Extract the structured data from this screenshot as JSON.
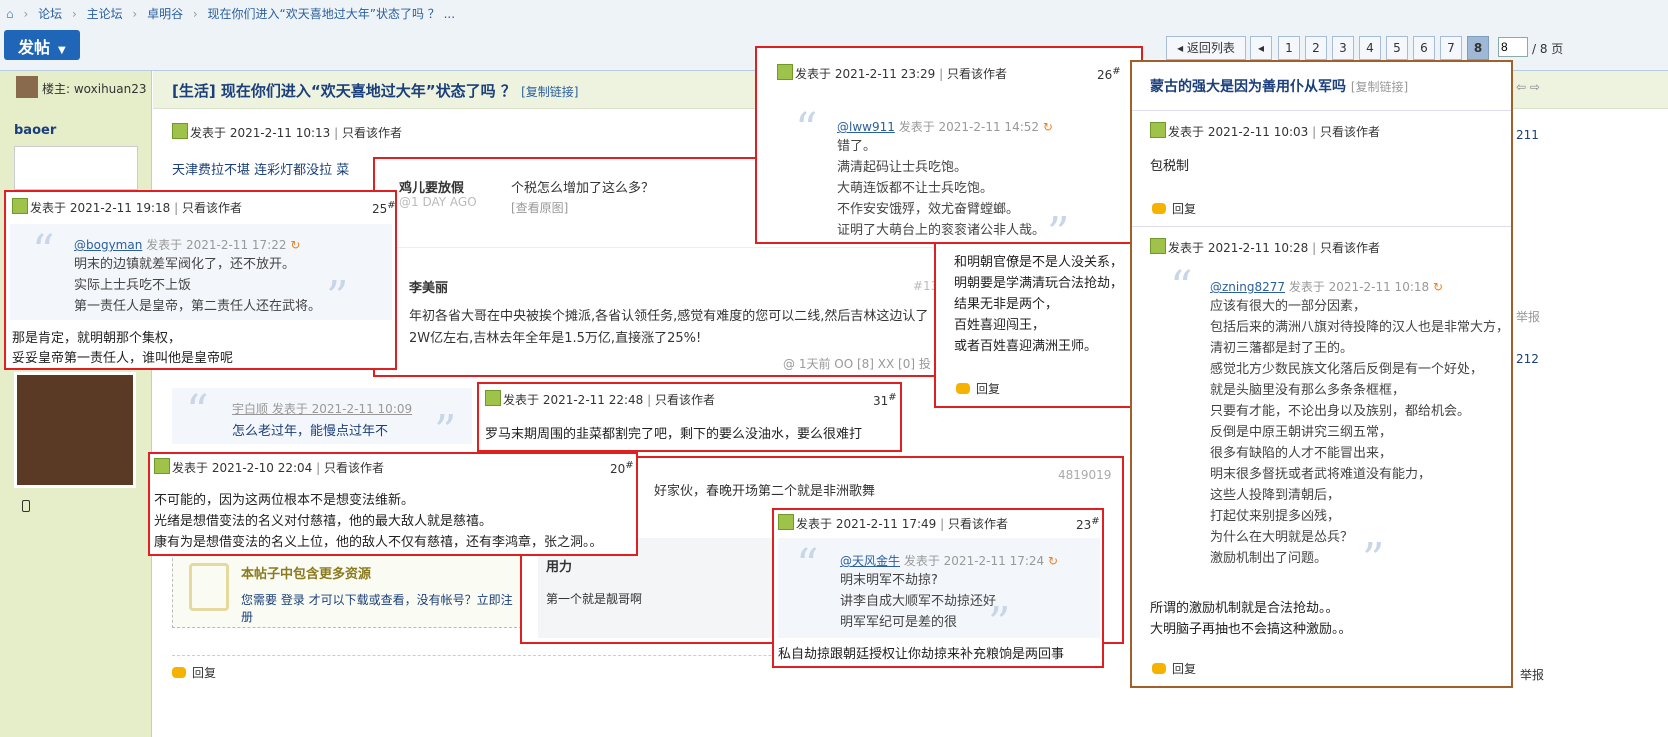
{
  "breadcrumb": {
    "items": [
      "论坛",
      "主论坛",
      "卓明谷",
      "现在你们进入“欢天喜地过大年”状态了吗 ？ ..."
    ]
  },
  "toolbar": {
    "post_label": "发帖"
  },
  "pager": {
    "back": "返回列表",
    "pages": [
      "1",
      "2",
      "3",
      "4",
      "5",
      "6",
      "7",
      "8"
    ],
    "current": "8",
    "input_value": "8",
    "total": "/ 8 页"
  },
  "thread": {
    "owner_label": "楼主: woxihuan23",
    "title": "[生活] 现在你们进入“欢天喜地过大年”状态了吗 ？",
    "copy_link": "[复制链接]"
  },
  "sidebar": {
    "username": "baoer"
  },
  "main_post": {
    "meta": "发表于 2021-2-11 10:13",
    "author_only": "只看该作者",
    "headline": "天津费拉不堪 连彩灯都没拉 菜",
    "quote_author": "宇白顺 发表于 2021-2-11 10:09",
    "quote_text": "怎么老过年，能慢点过年不",
    "resource_title": "本帖子中包含更多资源",
    "resource_text": "您需要 登录 才可以下载或查看，没有帐号？立即注册",
    "reply": "回复"
  },
  "right_edge": {
    "floor211": "211",
    "floor212": "212",
    "report": "举报"
  },
  "boxes": {
    "b25": {
      "meta": "发表于 2021-2-11 19:18",
      "author_only": "只看该作者",
      "floor": "25",
      "quote_user": "@bogyman",
      "quote_time": "发表于 2021-2-11 17:22",
      "quote_lines": [
        "明末的边镇就差军阀化了，还不放开。",
        "实际上士兵吃不上饭",
        "第一责任人是皇帝，第二责任人还在武将。"
      ],
      "body": [
        "那是肯定，就明朝那个集权，",
        "妥妥皇帝第一责任人，谁叫他是皇帝呢"
      ]
    },
    "weibo": {
      "name1": "鸡儿要放假",
      "time1": "@1 DAY AGO",
      "text1": "个税怎么增加了这么多？",
      "orig": "[查看原图]",
      "name2": "李美丽",
      "floor": "#13",
      "text2a": "年初各省大哥在中央被挨个摊派,各省认领任务,感觉有难度的您可以二线,然后吉林这边认了",
      "text2b": "2W亿左右,吉林去年全年是1.5万亿,直接涨了25%!",
      "footer": "@ 1天前  OO [8]  XX [0]  投"
    },
    "b26": {
      "meta": "发表于 2021-2-11 23:29",
      "author_only": "只看该作者",
      "floor": "26",
      "quote_user": "@lww911",
      "quote_time": "发表于 2021-2-11 14:52",
      "quote_lines": [
        "错了。",
        "满清起码让士兵吃饱。",
        "大萌连饭都不让士兵吃饱。",
        "不作安安饿殍，效尤奋臂螳螂。",
        "证明了大萌台上的衮衮诸公非人哉。"
      ]
    },
    "b26body": {
      "lines": [
        "和明朝官僚是不是人没关系，",
        "明朝要是学满清玩合法抢劫，",
        "结果无非是两个，",
        "百姓喜迎闯王，",
        "或者百姓喜迎满洲王师。"
      ],
      "reply": "回复"
    },
    "b31": {
      "meta": "发表于 2021-2-11 22:48",
      "author_only": "只看该作者",
      "floor": "31",
      "body": "罗马末期周围的韭菜都割完了吧，剩下的要么没油水，要么很难打"
    },
    "b20": {
      "meta": "发表于 2021-2-10 22:04",
      "author_only": "只看该作者",
      "floor": "20",
      "body": [
        "不可能的，因为这两位根本不是想变法维新。",
        "光绪是想借变法的名义对付慈禧，他的最大敌人就是慈禧。",
        "康有为是想借变法的名义上位，他的敌人不仅有慈禧，还有李鸿章，张之洞。。"
      ]
    },
    "bmid": {
      "text": "好家伙，春晚开场第二个就是非洲歌舞",
      "id": "4819019",
      "sub_title": "用力",
      "sub_text": "第一个就是靓哥啊"
    },
    "b23": {
      "meta": "发表于 2021-2-11 17:49",
      "author_only": "只看该作者",
      "floor": "23",
      "quote_user": "@天风金牛",
      "quote_time": "发表于 2021-2-11 17:24",
      "quote_lines": [
        "明末明军不劫掠?",
        "讲李自成大顺军不劫掠还好",
        "明军军纪可是差的很"
      ],
      "body": "私自劫掠跟朝廷授权让你劫掠来补充粮饷是两回事"
    },
    "bright": {
      "title": "蒙古的强大是因为善用仆从军吗",
      "copy": "[复制链接]",
      "meta1": "发表于 2021-2-11 10:03",
      "author_only": "只看该作者",
      "body1": "包税制",
      "reply": "回复",
      "meta2": "发表于 2021-2-11 10:28",
      "quote_user": "@zning8277",
      "quote_time": "发表于 2021-2-11 10:18",
      "quote_lines": [
        "应该有很大的一部分因素，",
        "包括后来的满洲八旗对待投降的汉人也是非常大方，",
        "清初三藩都是封了王的。",
        "感觉北方少数民族文化落后反倒是有一个好处，",
        "就是头脑里没有那么多条条框框，",
        "只要有才能，不论出身以及族别，都给机会。",
        "反倒是中原王朝讲究三纲五常，",
        "很多有缺陷的人才不能冒出来，",
        "明末很多督抚或者武将难道没有能力，",
        "这些人投降到清朝后，",
        "打起仗来别提多凶残，",
        "为什么在大明就是怂兵？",
        "激励机制出了问题。"
      ],
      "body2": [
        "所谓的激励机制就是合法抢劫。。",
        "大明脑子再抽也不会搞这种激励。。"
      ]
    }
  }
}
